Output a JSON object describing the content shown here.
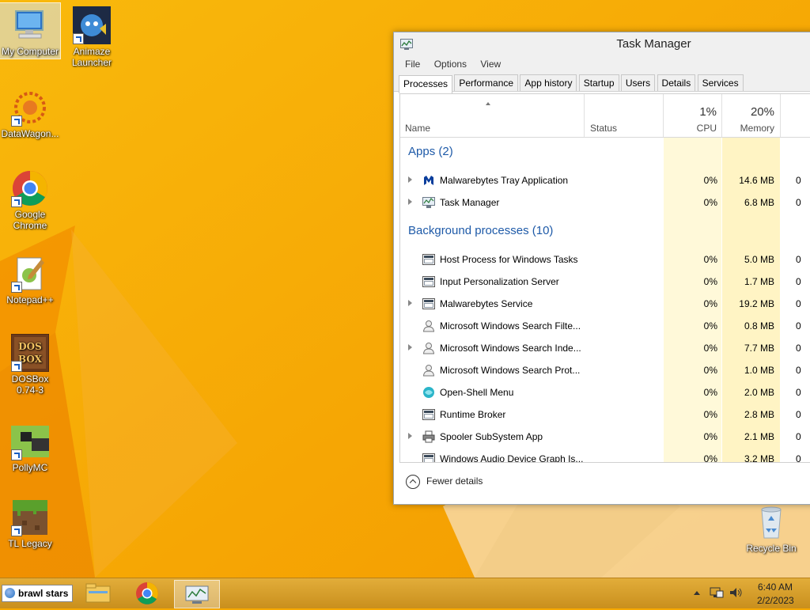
{
  "desktop": {
    "icons": [
      {
        "label": "My Computer",
        "icon": "computer-icon"
      },
      {
        "label": "Animaze Launcher",
        "icon": "animaze-icon"
      },
      {
        "label": "DataWagon...",
        "icon": "datawagon-icon"
      },
      {
        "label": "Google Chrome",
        "icon": "chrome-icon"
      },
      {
        "label": "Notepad++",
        "icon": "notepadpp-icon"
      },
      {
        "label": "DOSBox 0.74-3",
        "icon": "dosbox-icon"
      },
      {
        "label": "PollyMC",
        "icon": "pollymc-icon"
      },
      {
        "label": "TL Legacy",
        "icon": "minecraft-block-icon"
      },
      {
        "label": "Recycle Bin",
        "icon": "recycle-bin-icon"
      }
    ]
  },
  "task_manager": {
    "title": "Task Manager",
    "menu": [
      "File",
      "Options",
      "View"
    ],
    "tabs": [
      "Processes",
      "Performance",
      "App history",
      "Startup",
      "Users",
      "Details",
      "Services"
    ],
    "active_tab": "Processes",
    "columns": {
      "name": "Name",
      "status": "Status",
      "cpu_pct": "1%",
      "cpu_label": "CPU",
      "mem_pct": "20%",
      "mem_label": "Memory"
    },
    "groups": [
      {
        "title": "Apps (2)",
        "rows": [
          {
            "name": "Malwarebytes Tray Application",
            "cpu": "0%",
            "mem": "14.6 MB",
            "disk": "0",
            "expandable": true,
            "icon": "malwarebytes-icon"
          },
          {
            "name": "Task Manager",
            "cpu": "0%",
            "mem": "6.8 MB",
            "disk": "0",
            "expandable": true,
            "icon": "task-manager-icon"
          }
        ]
      },
      {
        "title": "Background processes (10)",
        "rows": [
          {
            "name": "Host Process for Windows Tasks",
            "cpu": "0%",
            "mem": "5.0 MB",
            "disk": "0",
            "expandable": false,
            "icon": "process-icon"
          },
          {
            "name": "Input Personalization Server",
            "cpu": "0%",
            "mem": "1.7 MB",
            "disk": "0",
            "expandable": false,
            "icon": "process-icon"
          },
          {
            "name": "Malwarebytes Service",
            "cpu": "0%",
            "mem": "19.2 MB",
            "disk": "0",
            "expandable": true,
            "icon": "process-icon"
          },
          {
            "name": "Microsoft Windows Search Filte...",
            "cpu": "0%",
            "mem": "0.8 MB",
            "disk": "0",
            "expandable": false,
            "icon": "person-icon"
          },
          {
            "name": "Microsoft Windows Search Inde...",
            "cpu": "0%",
            "mem": "7.7 MB",
            "disk": "0",
            "expandable": true,
            "icon": "person-icon"
          },
          {
            "name": "Microsoft Windows Search Prot...",
            "cpu": "0%",
            "mem": "1.0 MB",
            "disk": "0",
            "expandable": false,
            "icon": "person-icon"
          },
          {
            "name": "Open-Shell Menu",
            "cpu": "0%",
            "mem": "2.0 MB",
            "disk": "0",
            "expandable": false,
            "icon": "open-shell-icon"
          },
          {
            "name": "Runtime Broker",
            "cpu": "0%",
            "mem": "2.8 MB",
            "disk": "0",
            "expandable": false,
            "icon": "process-icon"
          },
          {
            "name": "Spooler SubSystem App",
            "cpu": "0%",
            "mem": "2.1 MB",
            "disk": "0",
            "expandable": true,
            "icon": "printer-icon"
          },
          {
            "name": "Windows Audio Device Graph Is...",
            "cpu": "0%",
            "mem": "3.2 MB",
            "disk": "0",
            "expandable": false,
            "icon": "process-icon"
          }
        ]
      }
    ],
    "footer_label": "Fewer details"
  },
  "taskbar": {
    "start_label": "brawl stars",
    "pinned": [
      "file-explorer-icon",
      "chrome-icon",
      "task-manager-icon"
    ],
    "clock_time": "6:40 AM",
    "clock_date": "2/2/2023"
  }
}
